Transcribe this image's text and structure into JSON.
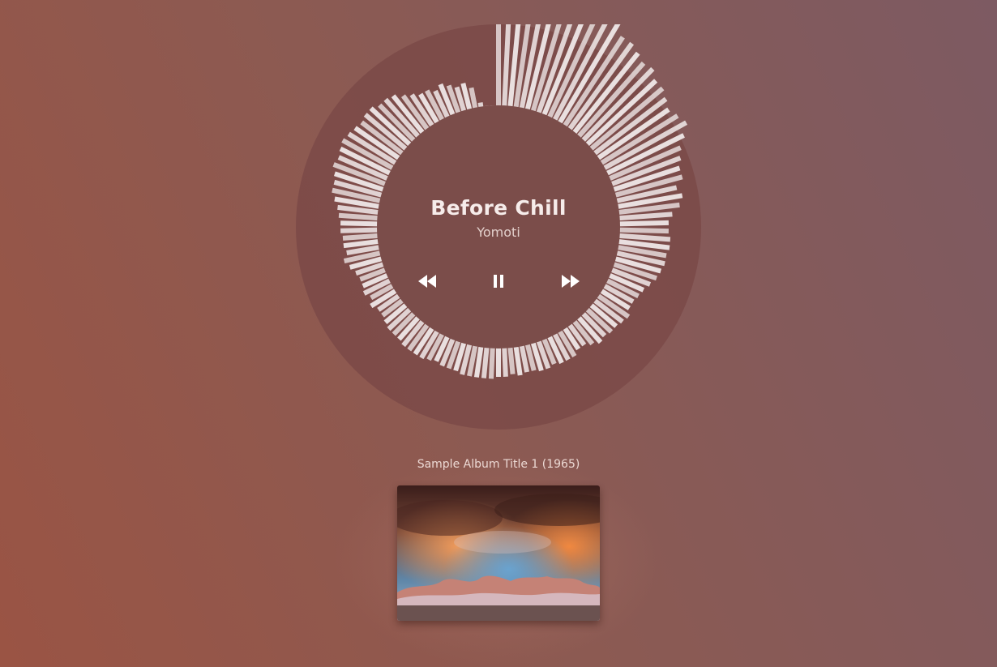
{
  "player": {
    "track_title": "Before Chill",
    "artist": "Yomoti",
    "state": "playing",
    "controls": {
      "previous": "rewind-icon",
      "play_pause": "pause-icon",
      "next": "fast-forward-icon"
    },
    "progress": 0.0
  },
  "visualizer": {
    "bar_levels": [
      0.78,
      0.8,
      0.8,
      0.81,
      0.8,
      0.83,
      0.81,
      0.82,
      0.78,
      0.8,
      0.78,
      0.8,
      0.72,
      0.72,
      0.7,
      0.68,
      0.69,
      0.66,
      0.66,
      0.64,
      0.62,
      0.64,
      0.66,
      0.62,
      0.58,
      0.56,
      0.54,
      0.54,
      0.5,
      0.52,
      0.5,
      0.46,
      0.44,
      0.44,
      0.45,
      0.45,
      0.44,
      0.44,
      0.43,
      0.42,
      0.4,
      0.38,
      0.37,
      0.36,
      0.36,
      0.38,
      0.37,
      0.36,
      0.36,
      0.35,
      0.36,
      0.34,
      0.32,
      0.32,
      0.34,
      0.34,
      0.34,
      0.33,
      0.34,
      0.34,
      0.33,
      0.33,
      0.34,
      0.33,
      0.34,
      0.34,
      0.35,
      0.35,
      0.35,
      0.35,
      0.35,
      0.34,
      0.34,
      0.34,
      0.33,
      0.34,
      0.35,
      0.35,
      0.35,
      0.35,
      0.34,
      0.34,
      0.34,
      0.33,
      0.32,
      0.32,
      0.34,
      0.32,
      0.34,
      0.33,
      0.33,
      0.34,
      0.36,
      0.38,
      0.36,
      0.37,
      0.37,
      0.38,
      0.38,
      0.39,
      0.4,
      0.42,
      0.44,
      0.44,
      0.45,
      0.47,
      0.46,
      0.47,
      0.48,
      0.47,
      0.46,
      0.45,
      0.46,
      0.46,
      0.44,
      0.44,
      0.43,
      0.4,
      0.38,
      0.36,
      0.36,
      0.34,
      0.36,
      0.34,
      0.32,
      0.33,
      0.3,
      0.22,
      0.14,
      0.05
    ],
    "bar_color": "#f4eeee",
    "ring_color": "#7a4846",
    "disc_color": "#7b4d4a"
  },
  "album": {
    "title": "Sample Album Title 1 (1965)",
    "cover_icon": "album-cover-landscape"
  },
  "colors": {
    "background_left": "#9a5444",
    "background_right": "#7d5a62",
    "text_primary": "#f6ecea",
    "text_secondary": "#e2cfcb"
  }
}
